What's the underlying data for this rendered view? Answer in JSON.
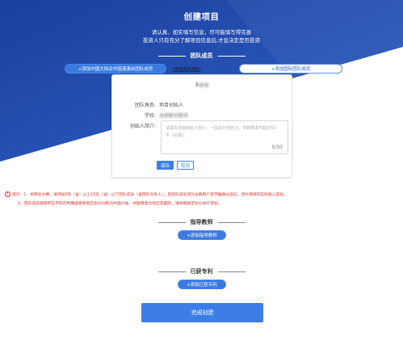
{
  "header": {
    "title": "创建项目",
    "intro_line1": "请认真、如实填写信息，尽可能填写得完善",
    "intro_line2": "投资人只有充分了解项目信息后,才会决定是否投资"
  },
  "team": {
    "heading": "团队成员",
    "add_mainland_label": "+添加中国大陆及中国港澳台团队成员",
    "view_flow_label": "(查看具体流程)",
    "add_international_label": "+添加国际团队成员"
  },
  "member_card": {
    "name": "3",
    "role_label": "团队角色:",
    "role_value": "项目创始人",
    "school_label": "学校:",
    "school_value": "北京航空航天",
    "intro_label": "创始人简介:",
    "intro_placeholder": "请填写项目创始人简介，一段话介绍自己，字数要求不超过50字（必填）。",
    "intro_counter": "0/50",
    "save_label": "保存",
    "cancel_label": "取消"
  },
  "tips": {
    "line1": "提示：1、如参加大赛，请添加3名（含）以上15名（含）以下团队成员（含团队负责人），且团队成员须为注册用户且学籍通过验证，须为项目的实际核心成员。",
    "line2": "2、团队成员按照所在学校的所属国家和地区划分分别为中国大陆、中国港澳台地区及国际，请按照规定划分进行添加。"
  },
  "advisor": {
    "heading": "指导教师",
    "add_label": "+添加指导教师"
  },
  "patent": {
    "heading": "已获专利",
    "add_label": "+添加已获专利"
  },
  "submit_label": "完成创建",
  "colors": {
    "hero_dark": "#1a3d9a",
    "hero_light": "#2a5ec4",
    "accent": "#3d7ee6",
    "tip_red": "#d9302c"
  }
}
